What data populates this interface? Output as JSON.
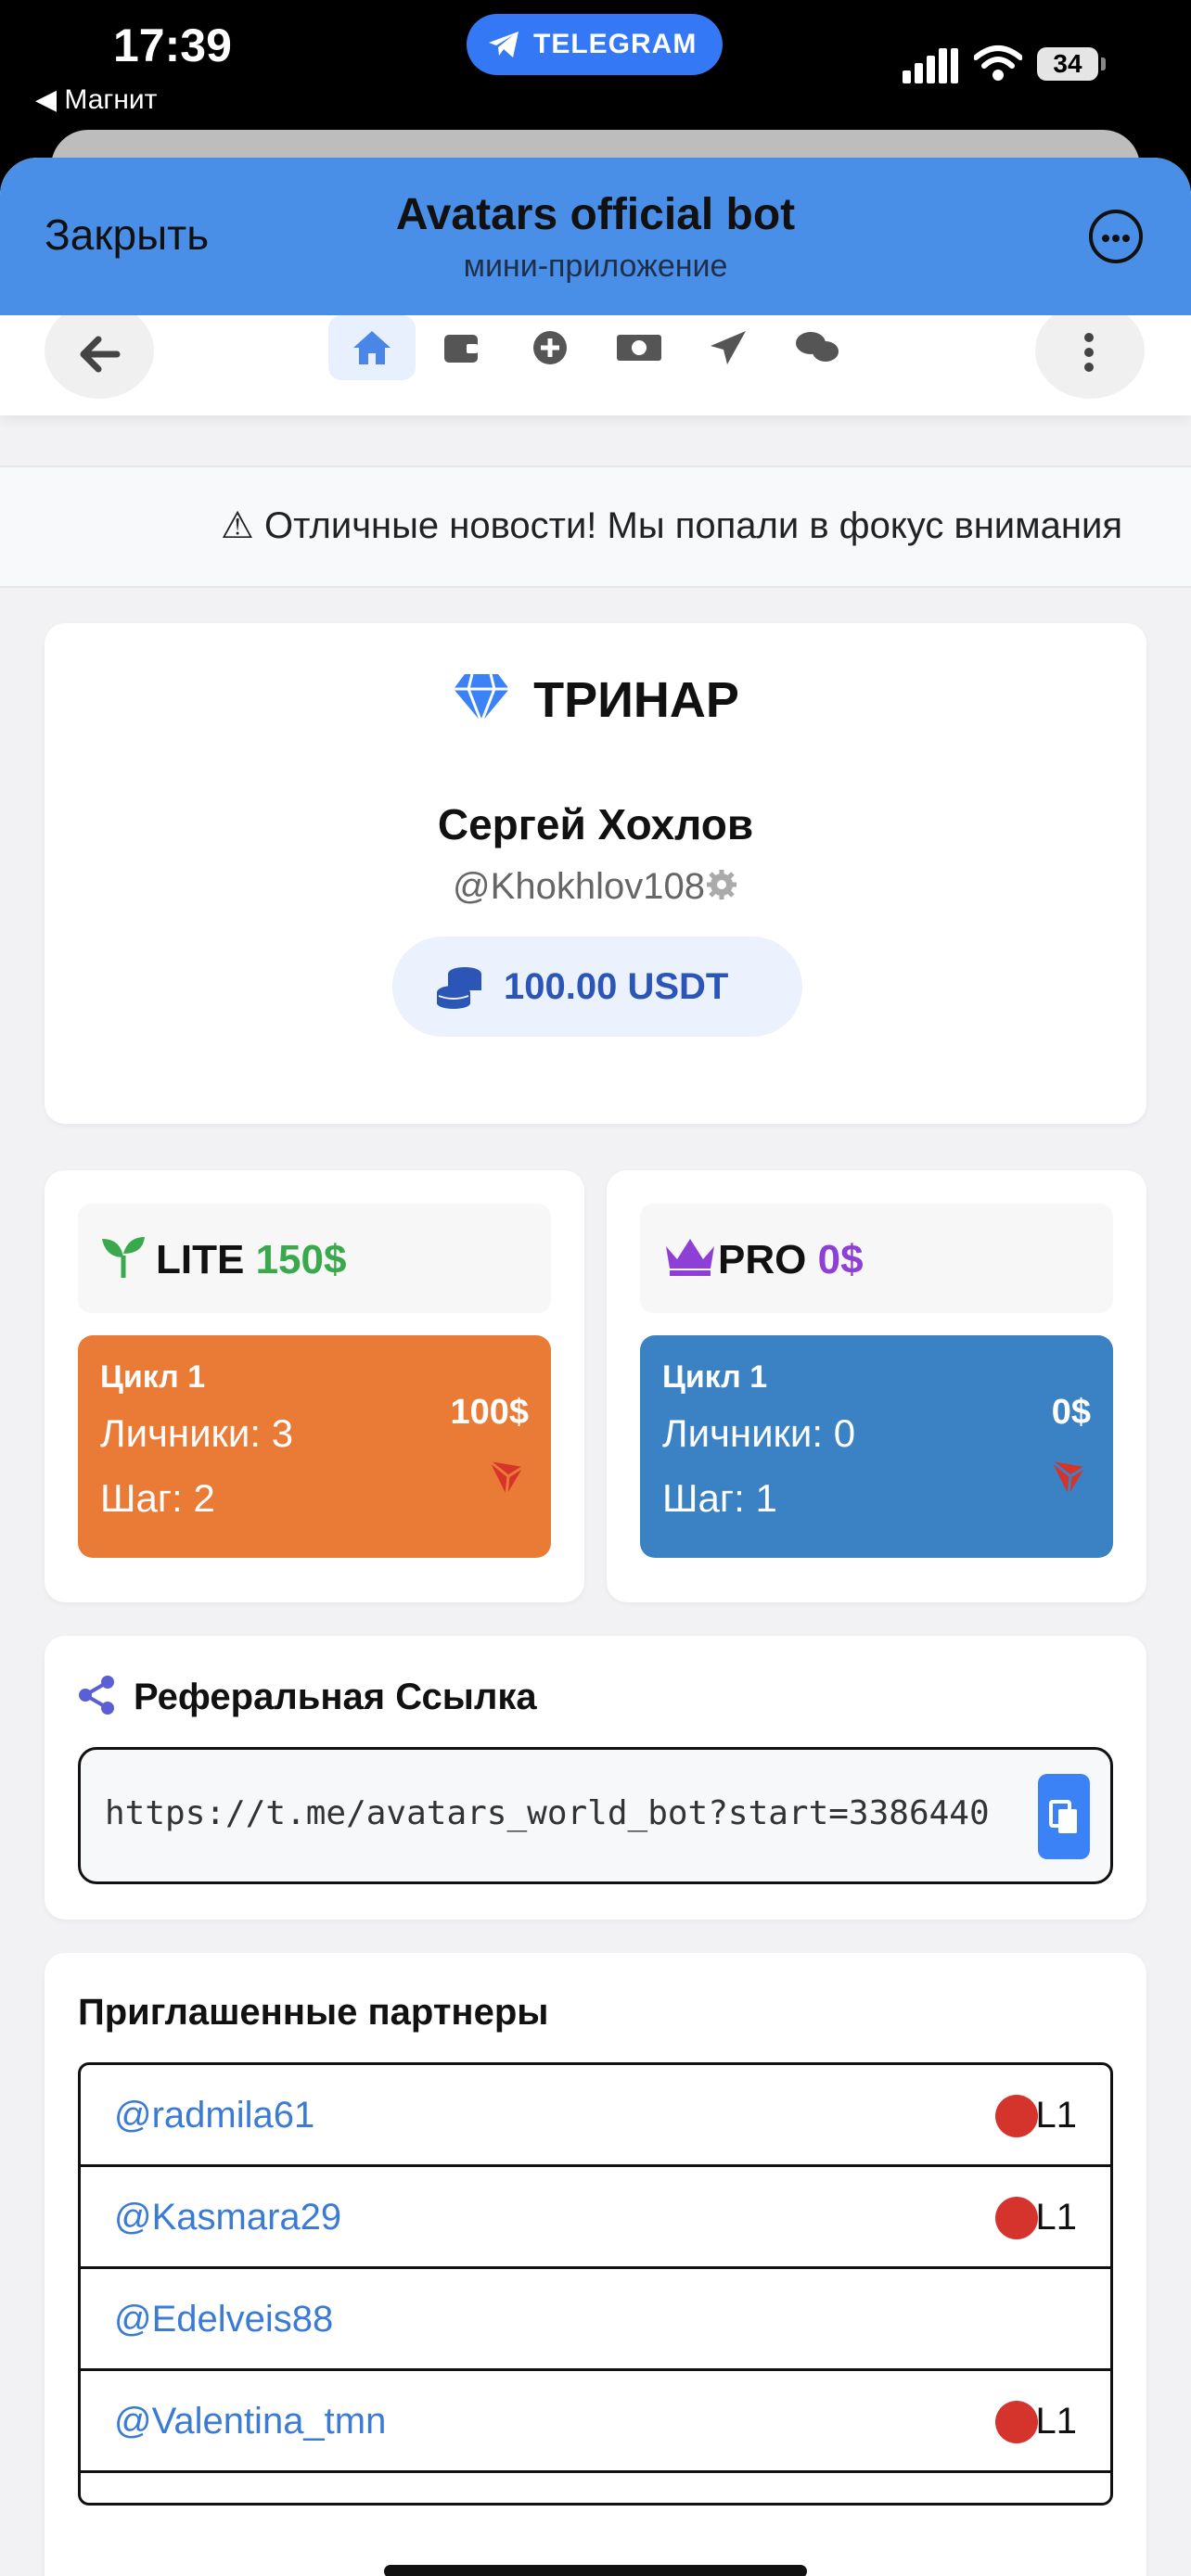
{
  "status_bar": {
    "time": "17:39",
    "back_app": "◀ Магнит",
    "pill": "TELEGRAM",
    "battery": "34"
  },
  "header": {
    "close": "Закрыть",
    "title": "Avatars official bot",
    "subtitle": "мини-приложение"
  },
  "nav": {
    "icons": [
      "home-icon",
      "wallet-icon",
      "plus-circle-icon",
      "money-icon",
      "send-icon",
      "chat-icon"
    ],
    "active": "home-icon"
  },
  "ticker": {
    "text": "⚠ Отличные новости! Мы попали в фокус внимания"
  },
  "profile": {
    "brand": "ТРИНАР",
    "name": "Сергей Хохлов",
    "handle": "@Khokhlov108",
    "balance": "100.00 USDT"
  },
  "plans": {
    "lite": {
      "name": "LITE",
      "price": "150$",
      "cycle": "Цикл 1",
      "personal": "Личники: 3",
      "step": "Шаг: 2",
      "amount": "100$",
      "color": "#ea7b36"
    },
    "pro": {
      "name": "PRO",
      "price": "0$",
      "cycle": "Цикл 1",
      "personal": "Личники: 0",
      "step": "Шаг: 1",
      "amount": "0$",
      "color": "#3a82c4"
    }
  },
  "referral": {
    "title": "Реферальная Ссылка",
    "url": "https://t.me/avatars_world_bot?start=3386440"
  },
  "partners": {
    "title": "Приглашенные партнеры",
    "rows": [
      {
        "handle": "@radmila61",
        "level": "L1"
      },
      {
        "handle": "@Kasmara29",
        "level": "L1"
      },
      {
        "handle": "@Edelveis88",
        "level": ""
      },
      {
        "handle": "@Valentina_tmn",
        "level": "L1"
      }
    ]
  }
}
